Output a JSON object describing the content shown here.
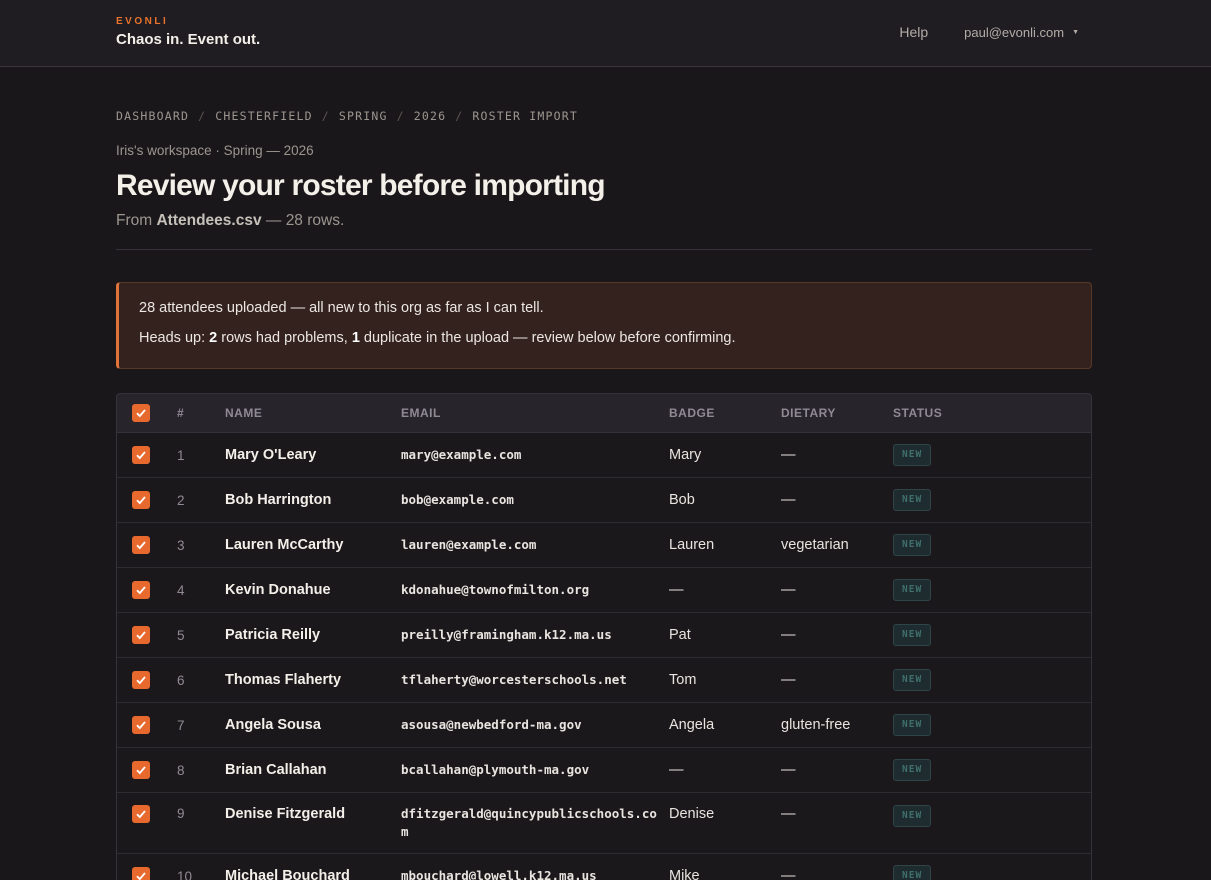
{
  "brand": {
    "name": "EVONLI",
    "tagline": "Chaos in. Event out."
  },
  "nav": {
    "help": "Help",
    "user": "paul@evonli.com"
  },
  "breadcrumb": [
    "DASHBOARD",
    "CHESTERFIELD",
    "SPRING",
    "2026",
    "ROSTER IMPORT"
  ],
  "workspace": "Iris's workspace · Spring — 2026",
  "title": "Review your roster before importing",
  "subtitle": {
    "prefix": "From ",
    "file": "Attendees.csv",
    "suffix": " — 28 rows."
  },
  "notice": {
    "line1": "28 attendees uploaded — all new to this org as far as I can tell.",
    "line2_a": "Heads up: ",
    "line2_b": "2",
    "line2_c": " rows had problems, ",
    "line2_d": "1",
    "line2_e": " duplicate in the upload — review below before confirming."
  },
  "table": {
    "headers": {
      "num": "#",
      "name": "NAME",
      "email": "EMAIL",
      "badge": "BADGE",
      "dietary": "DIETARY",
      "status": "STATUS"
    },
    "rows": [
      {
        "num": "1",
        "name": "Mary O'Leary",
        "email": "mary@example.com",
        "badge": "Mary",
        "dietary": "—",
        "status": "NEW"
      },
      {
        "num": "2",
        "name": "Bob Harrington",
        "email": "bob@example.com",
        "badge": "Bob",
        "dietary": "—",
        "status": "NEW"
      },
      {
        "num": "3",
        "name": "Lauren McCarthy",
        "email": "lauren@example.com",
        "badge": "Lauren",
        "dietary": "vegetarian",
        "status": "NEW"
      },
      {
        "num": "4",
        "name": "Kevin Donahue",
        "email": "kdonahue@townofmilton.org",
        "badge": "—",
        "dietary": "—",
        "status": "NEW"
      },
      {
        "num": "5",
        "name": "Patricia Reilly",
        "email": "preilly@framingham.k12.ma.us",
        "badge": "Pat",
        "dietary": "—",
        "status": "NEW"
      },
      {
        "num": "6",
        "name": "Thomas Flaherty",
        "email": "tflaherty@worcesterschools.net",
        "badge": "Tom",
        "dietary": "—",
        "status": "NEW"
      },
      {
        "num": "7",
        "name": "Angela Sousa",
        "email": "asousa@newbedford-ma.gov",
        "badge": "Angela",
        "dietary": "gluten-free",
        "status": "NEW"
      },
      {
        "num": "8",
        "name": "Brian Callahan",
        "email": "bcallahan@plymouth-ma.gov",
        "badge": "—",
        "dietary": "—",
        "status": "NEW"
      },
      {
        "num": "9",
        "name": "Denise Fitzgerald",
        "email": "dfitzgerald@quincypublicschools.com",
        "badge": "Denise",
        "dietary": "—",
        "status": "NEW"
      },
      {
        "num": "10",
        "name": "Michael Bouchard",
        "email": "mbouchard@lowell.k12.ma.us",
        "badge": "Mike",
        "dietary": "—",
        "status": "NEW"
      }
    ]
  },
  "colors": {
    "accent": "#e8692e",
    "background": "#1a171b",
    "notice_bg": "#34221f",
    "pill_text": "#3f6f6c"
  }
}
